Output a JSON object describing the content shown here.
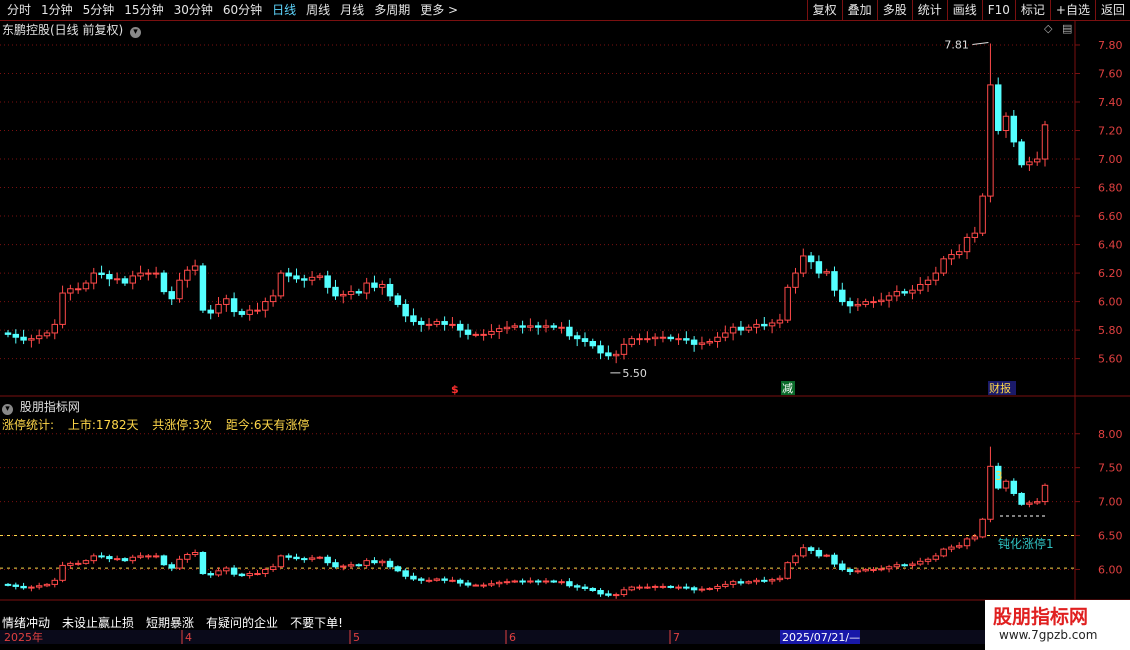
{
  "toolbar": {
    "left_items": [
      "分时",
      "1分钟",
      "5分钟",
      "15分钟",
      "30分钟",
      "60分钟",
      "日线",
      "周线",
      "月线",
      "多周期",
      "更多 >"
    ],
    "selected_index": 6,
    "right_buttons": [
      "复权",
      "叠加",
      "多股",
      "统计",
      "画线",
      "F10",
      "标记",
      "+自选",
      "返回"
    ]
  },
  "main_panel": {
    "title": "东鹏控股(日线 前复权)",
    "y_ticks": [
      "7.80",
      "7.60",
      "7.40",
      "7.20",
      "7.00",
      "6.80",
      "6.60",
      "6.40",
      "6.20",
      "6.00",
      "5.80",
      "5.60"
    ],
    "high_label": "7.81",
    "low_label": "5.50",
    "markers": {
      "s": "$",
      "reduce": "减",
      "report": "财报"
    }
  },
  "sub_panel": {
    "title": "股朋指标网",
    "stats": {
      "label": "涨停统计:",
      "listed": "上市:1782天",
      "count": "共涨停:3次",
      "since": "距今:6天有涨停"
    },
    "y_ticks": [
      "8.00",
      "7.50",
      "7.00",
      "6.50",
      "6.00"
    ],
    "count_label": "3",
    "note": "钝化涨停1"
  },
  "bottom_notes": [
    "情绪冲动",
    "未设止赢止损",
    "短期暴涨",
    "有疑问的企业",
    "不要下单!"
  ],
  "date_axis": {
    "year": "2025年",
    "months": [
      "4",
      "5",
      "6",
      "7"
    ],
    "cursor_date": "2025/07/21/—"
  },
  "watermark": {
    "title": "股朋指标网",
    "url": "www.7gpzb.com"
  },
  "colors": {
    "up": "#ff4a4a",
    "down": "#54ffff",
    "grid": "#7a1010",
    "text_yellow": "#ffd84a"
  },
  "chart_data": {
    "type": "candlestick",
    "closes": [
      5.77,
      5.75,
      5.73,
      5.74,
      5.76,
      5.78,
      5.84,
      6.06,
      6.09,
      6.09,
      6.13,
      6.2,
      6.19,
      6.16,
      6.16,
      6.13,
      6.18,
      6.2,
      6.2,
      6.2,
      6.07,
      6.02,
      6.15,
      6.22,
      6.25,
      5.94,
      5.92,
      5.98,
      6.02,
      5.93,
      5.91,
      5.94,
      5.94,
      6.0,
      6.04,
      6.2,
      6.18,
      6.16,
      6.15,
      6.17,
      6.18,
      6.1,
      6.04,
      6.05,
      6.07,
      6.06,
      6.13,
      6.1,
      6.12,
      6.04,
      5.98,
      5.9,
      5.86,
      5.84,
      5.84,
      5.86,
      5.84,
      5.84,
      5.8,
      5.77,
      5.77,
      5.77,
      5.79,
      5.81,
      5.82,
      5.83,
      5.82,
      5.83,
      5.82,
      5.83,
      5.82,
      5.82,
      5.76,
      5.74,
      5.72,
      5.69,
      5.64,
      5.62,
      5.63,
      5.7,
      5.74,
      5.74,
      5.74,
      5.75,
      5.75,
      5.74,
      5.74,
      5.73,
      5.7,
      5.71,
      5.72,
      5.75,
      5.78,
      5.82,
      5.8,
      5.82,
      5.84,
      5.83,
      5.85,
      5.87,
      6.1,
      6.2,
      6.32,
      6.28,
      6.2,
      6.21,
      6.08,
      6.0,
      5.97,
      5.98,
      6.0,
      6.0,
      6.01,
      6.04,
      6.07,
      6.06,
      6.08,
      6.12,
      6.15,
      6.2,
      6.3,
      6.33,
      6.35,
      6.45,
      6.48,
      6.74,
      7.52,
      7.2,
      7.3,
      7.12,
      6.96,
      6.98,
      7.0,
      7.24
    ],
    "high_label": 7.81,
    "low_label": 5.5,
    "ylim": [
      5.45,
      7.87
    ]
  }
}
